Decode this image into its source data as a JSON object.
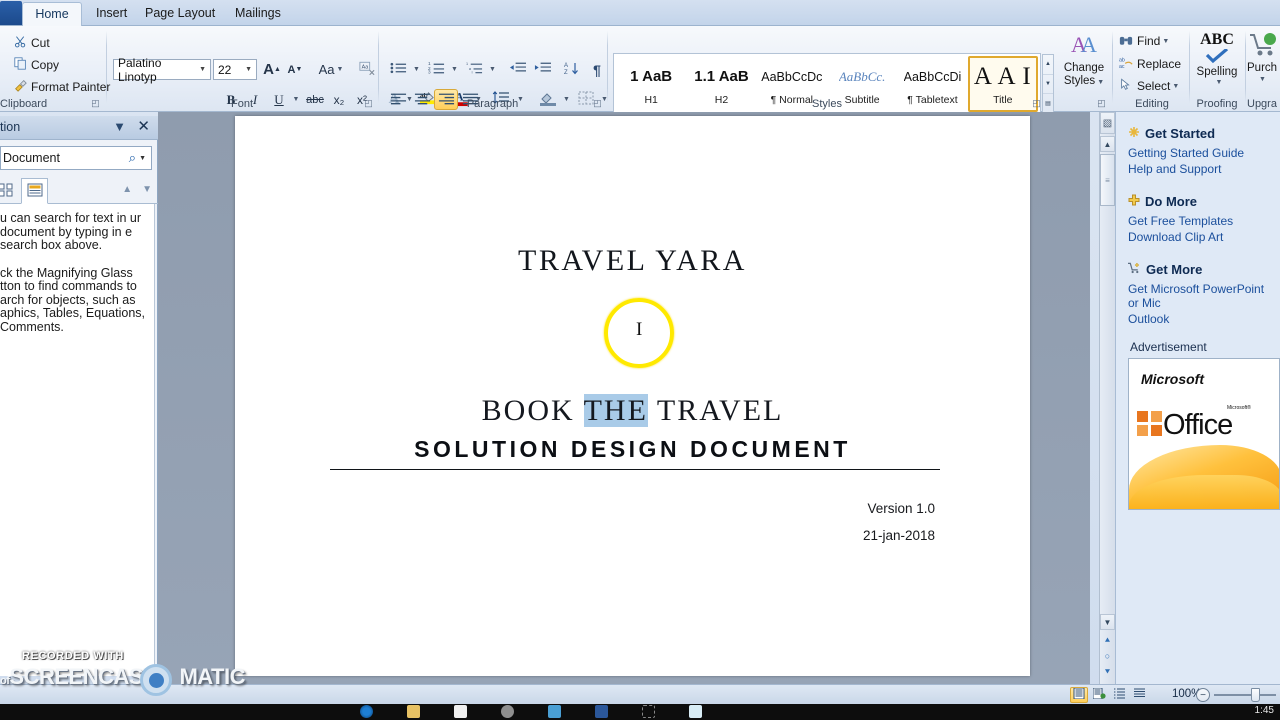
{
  "tabs": [
    {
      "label": "Home",
      "active": true
    },
    {
      "label": "Insert",
      "active": false
    },
    {
      "label": "Page Layout",
      "active": false
    },
    {
      "label": "Mailings",
      "active": false
    }
  ],
  "ribbon": {
    "clipboard": {
      "group_label": "Clipboard",
      "cut": "Cut",
      "copy": "Copy",
      "format_painter": "Format Painter",
      "cut_icon": "scissors-icon",
      "copy_icon": "copy-icon",
      "format_painter_icon": "paintbrush-icon"
    },
    "font": {
      "group_label": "Font",
      "font_name": "Palatino Linotyp",
      "font_size": "22",
      "grow_font": "A",
      "shrink_font": "A",
      "change_case": "Aa",
      "clear_formatting": "clear-formatting-icon",
      "bold": "B",
      "italic": "I",
      "underline": "U",
      "strikethrough": "abc",
      "subscript": "x₂",
      "superscript": "x²",
      "text_effects": "A",
      "highlight": "ab",
      "font_color": "A"
    },
    "paragraph": {
      "group_label": "Paragraph",
      "bullets": "bullets-icon",
      "numbering": "numbering-icon",
      "multilevel": "multilevel-list-icon",
      "decrease_indent": "decrease-indent-icon",
      "increase_indent": "increase-indent-icon",
      "sort": "sort-icon",
      "show_marks": "¶",
      "align_left": "align-left-icon",
      "align_center": "align-center-icon",
      "align_right": "align-right-icon",
      "justify": "justify-icon",
      "line_spacing": "line-spacing-icon",
      "shading": "shading-icon",
      "borders": "borders-icon"
    },
    "styles": {
      "group_label": "Styles",
      "items": [
        {
          "preview": "1 AaB",
          "name": "H1",
          "selected": false
        },
        {
          "preview": "1.1 AaB",
          "name": "H2",
          "selected": false
        },
        {
          "preview": "AaBbCcDc",
          "name": "¶ Normal",
          "selected": false
        },
        {
          "preview": "AaBbCc.",
          "name": "Subtitle",
          "selected": false
        },
        {
          "preview": "AaBbCcDi",
          "name": "¶ Tabletext",
          "selected": false
        },
        {
          "preview": "A A I",
          "name": "Title",
          "selected": true
        }
      ],
      "change_styles_line1": "Change",
      "change_styles_line2": "Styles",
      "change_styles_icon": "change-styles-icon"
    },
    "editing": {
      "group_label": "Editing",
      "find": "Find",
      "replace": "Replace",
      "select": "Select",
      "find_icon": "binoculars-icon",
      "replace_icon": "replace-icon",
      "select_icon": "cursor-select-icon"
    },
    "proofing": {
      "group_label": "Proofing",
      "spelling_icon": "abc-check-icon",
      "spelling_top": "ABC",
      "spelling": "Spelling"
    },
    "upgrade": {
      "group_label": "Upgra",
      "purchase": "Purch",
      "purchase_icon": "shopping-cart-icon"
    }
  },
  "navigation_pane": {
    "title": "tion",
    "search_placeholder": "Document",
    "search_icon": "magnifier-icon",
    "collapse_icon": "chevron-down-icon",
    "close_icon": "close-icon",
    "tab_thumbnails": "thumbnails-icon",
    "tab_results": "results-icon",
    "prev_icon": "triangle-up-icon",
    "next_icon": "triangle-down-icon",
    "help_paragraph_1": "u can search for text in ur document by typing in e search box above.",
    "help_paragraph_2": "ck the Magnifying Glass tton to find commands to arch for objects, such as aphics, Tables, Equations, Comments."
  },
  "document": {
    "title": "TRAVEL YARA",
    "heading_before": "BOOK ",
    "heading_selected": "THE",
    "heading_after": " TRAVEL",
    "subtitle": "SOLUTION DESIGN DOCUMENT",
    "version": "Version 1.0",
    "date": "21-jan-2018",
    "cursor_icon": "text-cursor-icon",
    "highlight_circle_color": "#ffe900",
    "selection_color": "#a9cbe8"
  },
  "scrollbar": {
    "select_browse_object_icon": "browse-object-icon",
    "scroll_up_icon": "triangle-up-icon",
    "scroll_down_icon": "triangle-down-icon",
    "previous_page_icon": "previous-page-icon",
    "browse_icon": "circle-icon",
    "next_page_icon": "next-page-icon",
    "thumb": "scroll-thumb"
  },
  "right_panel": {
    "sections": [
      {
        "heading": "Get Started",
        "icon": "sparkle-icon",
        "links": [
          "Getting Started Guide",
          "Help and Support"
        ]
      },
      {
        "heading": "Do More",
        "icon": "plus-cross-icon",
        "links": [
          "Get Free Templates",
          "Download Clip Art"
        ]
      },
      {
        "heading": "Get More",
        "icon": "cart-plus-icon",
        "links": [
          "Get Microsoft PowerPoint or Mic",
          "Outlook"
        ]
      }
    ],
    "ad_label": "Advertisement",
    "ad_brand": "Microsoft",
    "ad_product": "Office",
    "ad_superscript": "Microsoft®",
    "ad_icon": "office-logo-icon"
  },
  "status_bar": {
    "view_print_layout": "print-layout-icon",
    "view_full_screen": "full-screen-reading-icon",
    "view_web_layout": "web-layout-icon",
    "view_outline": "outline-icon",
    "zoom_level": "100%",
    "zoom_out_icon": "minus-icon",
    "zoom_slider": "zoom-slider"
  },
  "watermark": {
    "line1": "RECORDED WITH",
    "prefix": "of",
    "line2_left": "SCREENCAST",
    "line2_right": "MATIC",
    "dot_icon": "record-dot-icon"
  },
  "taskbar": {
    "clock": "1:45",
    "icons": [
      "browser-icon",
      "folder-icon",
      "shop-icon",
      "settings-icon",
      "media-icon",
      "word-icon",
      "placeholder-icon",
      "file-icon"
    ]
  }
}
